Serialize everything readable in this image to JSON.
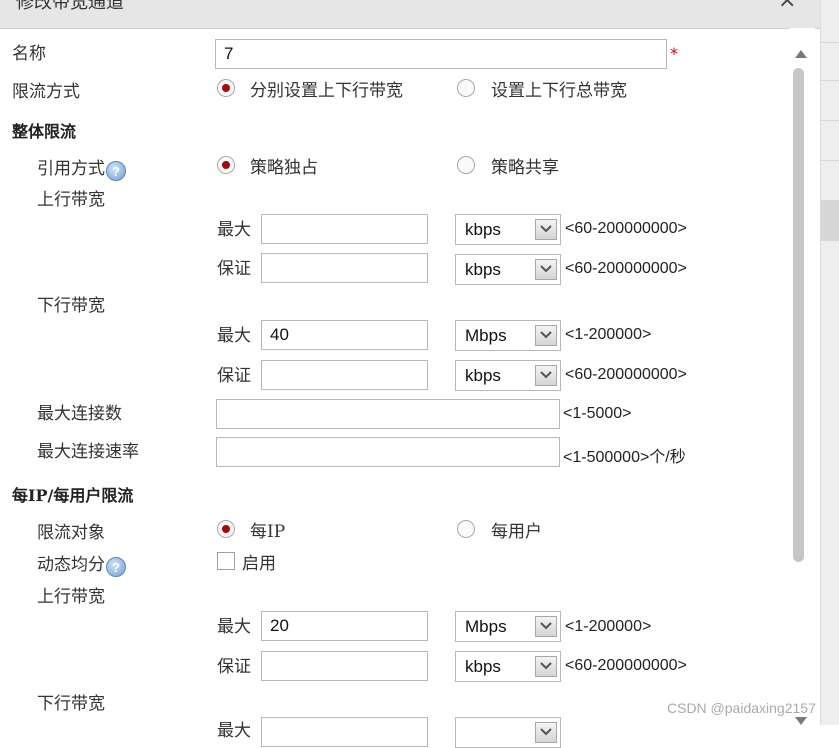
{
  "dialog": {
    "title": "修改带宽通道",
    "close": "×"
  },
  "form": {
    "name_label": "名称",
    "name_value": "7",
    "required_mark": "*",
    "limit_mode_label": "限流方式",
    "limit_mode_options": [
      "分别设置上下行带宽",
      "设置上下行总带宽"
    ],
    "limit_mode_selected": 0,
    "overall": {
      "section_title": "整体限流",
      "ref_mode_label": "引用方式",
      "ref_mode_options": [
        "策略独占",
        "策略共享"
      ],
      "ref_mode_selected": 0,
      "uplink_label": "上行带宽",
      "uplink_max_label": "最大",
      "uplink_max_value": "",
      "uplink_max_unit": "kbps",
      "uplink_max_range": "<60-200000000>",
      "uplink_guarantee_label": "保证",
      "uplink_guarantee_value": "",
      "uplink_guarantee_unit": "kbps",
      "uplink_guarantee_range": "<60-200000000>",
      "downlink_label": "下行带宽",
      "downlink_max_label": "最大",
      "downlink_max_value": "40",
      "downlink_max_unit": "Mbps",
      "downlink_max_range": "<1-200000>",
      "downlink_guarantee_label": "保证",
      "downlink_guarantee_value": "",
      "downlink_guarantee_unit": "kbps",
      "downlink_guarantee_range": "<60-200000000>",
      "max_conn_label": "最大连接数",
      "max_conn_range": "<1-5000>",
      "max_conn_rate_label": "最大连接速率",
      "max_conn_rate_range": "<1-500000>个/秒"
    },
    "per_user": {
      "section_title": "每IP/每用户限流",
      "target_label": "限流对象",
      "target_options": [
        "每IP",
        "每用户"
      ],
      "target_selected": 0,
      "dynamic_label": "动态均分",
      "dynamic_checkbox_label": "启用",
      "dynamic_enabled": false,
      "uplink_label": "上行带宽",
      "uplink_max_label": "最大",
      "uplink_max_value": "20",
      "uplink_max_unit": "Mbps",
      "uplink_max_range": "<1-200000>",
      "uplink_guarantee_label": "保证",
      "uplink_guarantee_value": "",
      "uplink_guarantee_unit": "kbps",
      "uplink_guarantee_range": "<60-200000000>",
      "downlink_label": "下行带宽",
      "downlink_max_label": "最大"
    },
    "help_icon_text": "?"
  },
  "watermark": "CSDN @paidaxing2157",
  "colors": {
    "radio_selected": "#a8070b",
    "required": "#d00000"
  }
}
